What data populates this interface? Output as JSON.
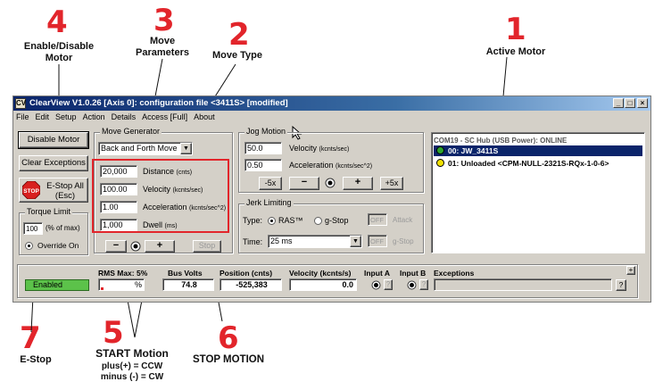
{
  "callouts": {
    "c1": {
      "num": "1",
      "label": "Active Motor"
    },
    "c2": {
      "num": "2",
      "label": "Move Type"
    },
    "c3": {
      "num": "3",
      "label": "Move\nParameters"
    },
    "c4": {
      "num": "4",
      "label": "Enable/Disable\nMotor"
    },
    "c5": {
      "num": "5",
      "label": "START Motion",
      "sub1": "plus(+) = CCW",
      "sub2": "minus (-) = CW"
    },
    "c6": {
      "num": "6",
      "label": "STOP MOTION"
    },
    "c7": {
      "num": "7",
      "label": "E-Stop"
    }
  },
  "window": {
    "title": "ClearView V1.0.26 [Axis 0]: configuration file <3411S> [modified]",
    "icon": "CV",
    "controls": [
      "_",
      "□",
      "×"
    ],
    "menu": [
      "File",
      "Edit",
      "Setup",
      "Action",
      "Details",
      "Access [Full]",
      "About"
    ]
  },
  "left": {
    "disable_motor": "Disable Motor",
    "clear_exceptions": "Clear Exceptions",
    "estop_badge": "STOP",
    "estop_line1": "E-Stop All",
    "estop_line2": "(Esc)",
    "torque_title": "Torque Limit",
    "torque_value": "100",
    "torque_unit": "(% of max)",
    "override_label": "Override On"
  },
  "move_generator": {
    "title": "Move Generator",
    "move_type": "Back and Forth Move",
    "params": [
      {
        "value": "20,000",
        "label": "Distance",
        "unit": "(cnts)"
      },
      {
        "value": "100.00",
        "label": "Velocity",
        "unit": "(kcnts/sec)"
      },
      {
        "value": "1.00",
        "label": "Acceleration",
        "unit": "(kcnts/sec^2)"
      },
      {
        "value": "1,000",
        "label": "Dwell",
        "unit": "(ms)"
      }
    ],
    "minus": "−",
    "plus": "+",
    "stop": "Stop"
  },
  "jog": {
    "title": "Jog Motion",
    "velocity_value": "50.0",
    "velocity_label": "Velocity",
    "velocity_unit": "(kcnts/sec)",
    "accel_value": "0.50",
    "accel_label": "Acceleration",
    "accel_unit": "(kcnts/sec^2)",
    "b_minus5": "-5x",
    "b_minus": "−",
    "b_plus": "+",
    "b_plus5": "+5x"
  },
  "jerk": {
    "title": "Jerk Limiting",
    "type_label": "Type:",
    "ras_label": "RAS™",
    "gstop_label": "g-Stop",
    "off1": "OFF",
    "attack": "Attack",
    "time_label": "Time:",
    "time_value": "25 ms",
    "off2": "OFF",
    "gstop2": "g-Stop"
  },
  "hub": {
    "header": "COM19 - SC Hub (USB Power):  ONLINE",
    "motors": [
      {
        "text": "00: JW_3411S",
        "color": "#2ea62e",
        "selected": true
      },
      {
        "text": "01: Unloaded <CPM-NULL-2321S-RQx-1-0-6>",
        "color": "#f0e000",
        "selected": false
      }
    ]
  },
  "status": {
    "enabled": "Enabled",
    "rms_label": "RMS Max: 5%",
    "rms_value": "%",
    "bus_label": "Bus Volts",
    "bus_value": "74.8",
    "pos_label": "Position (cnts)",
    "pos_value": "-525,383",
    "vel_label": "Velocity (kcnts/s)",
    "vel_value": "0.0",
    "inputa_label": "Input A",
    "inputb_label": "Input B",
    "exc_label": "Exceptions",
    "q": "?",
    "plus": "+"
  }
}
